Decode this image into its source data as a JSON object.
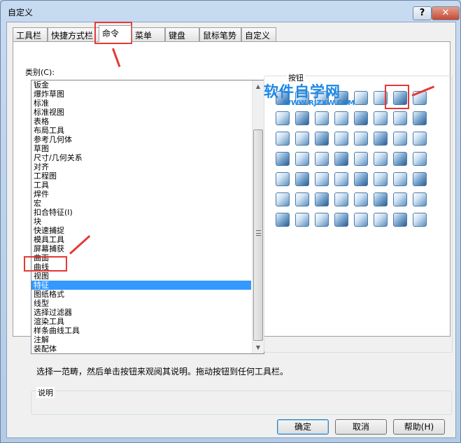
{
  "window": {
    "title": "自定义",
    "help_glyph": "?",
    "close_glyph": "✕"
  },
  "tabs": [
    {
      "label": "工具栏"
    },
    {
      "label": "快捷方式栏"
    },
    {
      "label": "命令"
    },
    {
      "label": "菜单"
    },
    {
      "label": "键盘"
    },
    {
      "label": "鼠标笔势"
    },
    {
      "label": "自定义"
    }
  ],
  "active_tab": "命令",
  "category": {
    "label": "类别(C):",
    "items": [
      "钣金",
      "爆炸草图",
      "标准",
      "标准视图",
      "表格",
      "布局工具",
      "参考几何体",
      "草图",
      "尺寸/几何关系",
      "对齐",
      "工程图",
      "工具",
      "焊件",
      "宏",
      "扣合特征(I)",
      "块",
      "快速捕捉",
      "模具工具",
      "屏幕捕获",
      "曲面",
      "曲线",
      "视图",
      "特征",
      "图纸格式",
      "线型",
      "选择过滤器",
      "渲染工具",
      "样条曲线工具",
      "注解",
      "装配体"
    ],
    "selected": "特征"
  },
  "buttons_group_label": "按钮",
  "description": {
    "hint": "选择一范畴，然后单击按钮来观阅其说明。拖动按钮到任何工具栏。",
    "label": "说明"
  },
  "dialog_buttons": {
    "ok": "确定",
    "cancel": "取消",
    "help": "帮助(H)"
  },
  "watermark": {
    "main": "软件自学网",
    "sub": "WWW.RJZXW.COM"
  },
  "icons": [
    "extrude-boss-icon",
    "revolve-boss-icon",
    "sweep-boss-icon",
    "loft-boss-icon",
    "extrude-cut-icon",
    "revolve-cut-icon",
    "sweep-cut-icon",
    "loft-cut-icon",
    "fillet-icon",
    "chamfer-icon",
    "rib-icon",
    "draft-icon",
    "shell-icon",
    "dome-icon",
    "shape-icon",
    "curve-driven-pattern-icon",
    "hole-icon",
    "wrap-icon",
    "flex-icon",
    "indent-icon",
    "deform-icon",
    "freeform-icon",
    "move-face-icon",
    "delete-face-icon",
    "split-icon",
    "combine-icon",
    "intersect-icon",
    "thicken-icon",
    "boundary-icon",
    "surface-cut-icon",
    "cavity-icon",
    "scale-icon",
    "linear-pattern-icon",
    "mirror-icon",
    "circular-pattern-icon",
    "table-pattern-icon",
    "sketch-pattern-icon",
    "fill-pattern-icon",
    "variable-pattern-icon",
    "derived-pattern-icon",
    "library-feature-icon",
    "hole-wizard-icon",
    "advanced-hole-icon",
    "thread-icon",
    "stud-icon",
    "cosmetic-thread-icon",
    "fastening-icon",
    "lip-groove-icon",
    "imported-icon",
    "feature-works-icon",
    "move-copy-icon",
    "body-delete-icon",
    "reference-icon",
    "pattern-assembly-icon",
    "check-icon",
    "grid-3d-icon"
  ]
}
